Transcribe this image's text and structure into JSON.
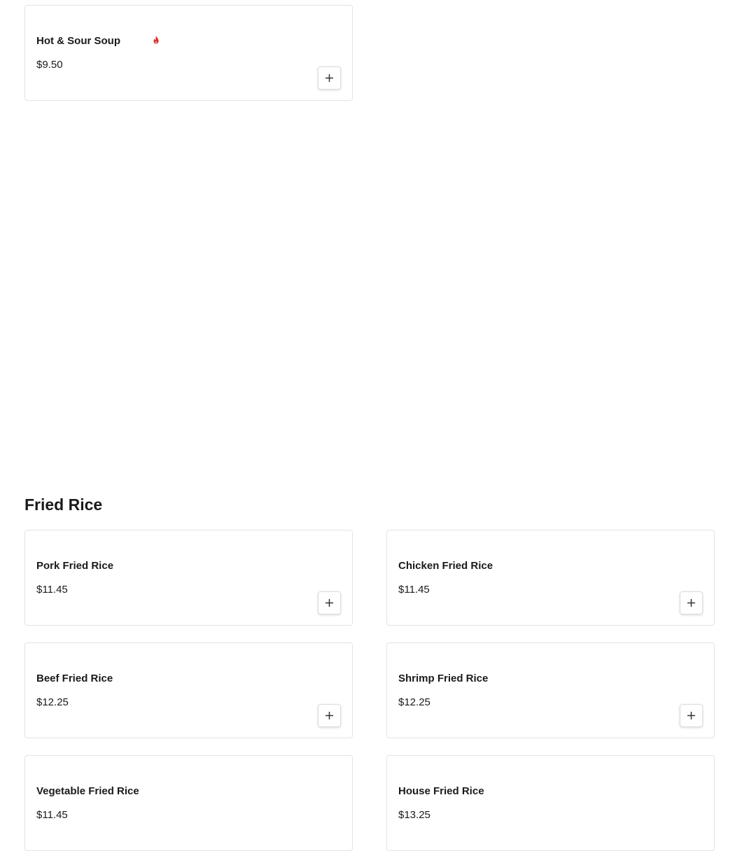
{
  "colors": {
    "spicy": "#d32f2f",
    "border": "#e3e3e3",
    "text": "#1a1a1a"
  },
  "top_item": {
    "name": "Hot & Sour Soup",
    "price": "$9.50",
    "icon": "spicy-flame-icon"
  },
  "fried_rice": {
    "title": "Fried Rice",
    "items": [
      {
        "name": "Pork Fried Rice",
        "price": "$11.45"
      },
      {
        "name": "Chicken Fried Rice",
        "price": "$11.45"
      },
      {
        "name": "Beef Fried Rice",
        "price": "$12.25"
      },
      {
        "name": "Shrimp Fried Rice",
        "price": "$12.25"
      },
      {
        "name": "Vegetable Fried Rice",
        "price": "$11.45"
      },
      {
        "name": "House Fried Rice",
        "price": "$13.25"
      }
    ]
  },
  "add_icon": "plus-icon"
}
